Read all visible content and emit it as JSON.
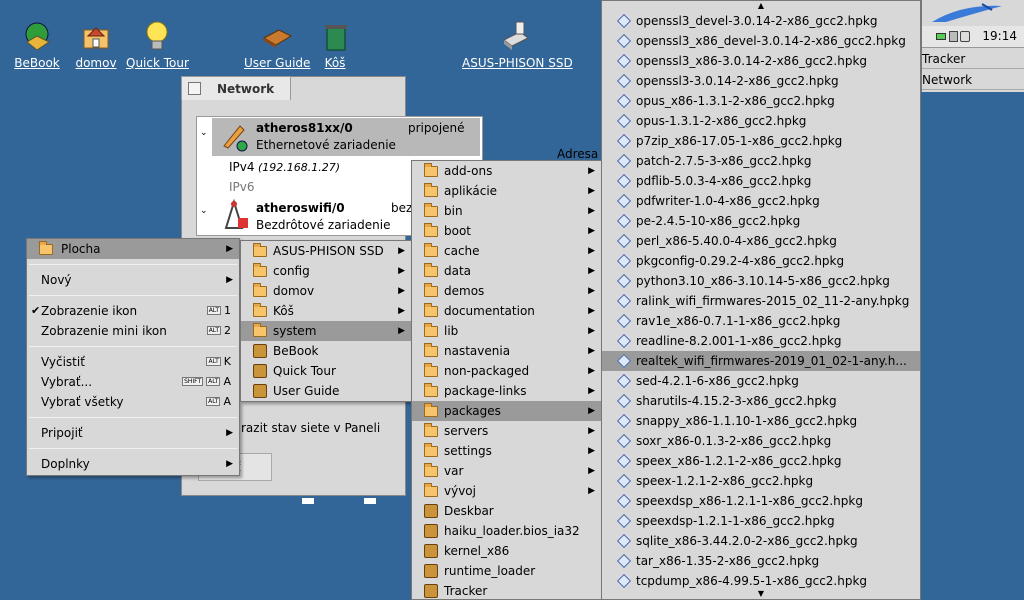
{
  "desktop_icons": [
    {
      "label": "BeBook",
      "icon": "book-globe-icon"
    },
    {
      "label": "domov",
      "icon": "home-folder-icon"
    },
    {
      "label": "Quick Tour",
      "icon": "lightbulb-icon"
    },
    {
      "label": "User Guide",
      "icon": "book-icon"
    },
    {
      "label": "Kôš",
      "icon": "trash-icon"
    },
    {
      "label": "ASUS-PHISON SSD",
      "icon": "drive-icon"
    }
  ],
  "network_window": {
    "title": "Network",
    "column_header": "Adresa",
    "iface1": {
      "name": "atheros81xx/0",
      "status": "pripojené",
      "type": "Ethernetové zariadenie",
      "ipv4_label": "IPv4",
      "ipv4_value": "(192.168.1.27)",
      "ipv6_label": "IPv6"
    },
    "iface2": {
      "name": "atheroswifi/0",
      "status": "bez",
      "type": "Bezdrôtové zariadenie"
    },
    "status_check": "razit stav siete v Paneli",
    "button": "iť"
  },
  "context_menu": {
    "items": [
      {
        "label": "Plocha",
        "submenu": true,
        "selected": true
      },
      {
        "sep": true
      },
      {
        "label": "Nový",
        "submenu": true
      },
      {
        "sep": true
      },
      {
        "label": "Zobrazenie ikon",
        "checked": true,
        "shortcut_key": "1"
      },
      {
        "label": "Zobrazenie mini ikon",
        "shortcut_key": "2"
      },
      {
        "sep": true
      },
      {
        "label": "Vyčistiť",
        "shortcut_key": "K"
      },
      {
        "label": "Vybrať...",
        "shift": true,
        "shortcut_key": "A"
      },
      {
        "label": "Vybrať všetky",
        "shortcut_key": "A"
      },
      {
        "sep": true
      },
      {
        "label": "Pripojiť",
        "submenu": true
      },
      {
        "sep": true
      },
      {
        "label": "Doplnky",
        "submenu": true
      }
    ],
    "alt_label": "ALT",
    "shift_label": "SHIFT"
  },
  "plocha_menu": [
    {
      "label": "ASUS-PHISON SSD",
      "submenu": true
    },
    {
      "label": "config",
      "submenu": true
    },
    {
      "label": "domov",
      "submenu": true
    },
    {
      "label": "Kôš",
      "submenu": true
    },
    {
      "label": "system",
      "submenu": true,
      "selected": true
    },
    {
      "label": "BeBook"
    },
    {
      "label": "Quick Tour"
    },
    {
      "label": "User Guide"
    }
  ],
  "system_menu": [
    {
      "label": "add-ons",
      "submenu": true
    },
    {
      "label": "aplikácie",
      "submenu": true
    },
    {
      "label": "bin",
      "submenu": true
    },
    {
      "label": "boot",
      "submenu": true
    },
    {
      "label": "cache",
      "submenu": true
    },
    {
      "label": "data",
      "submenu": true
    },
    {
      "label": "demos",
      "submenu": true
    },
    {
      "label": "documentation",
      "submenu": true
    },
    {
      "label": "lib",
      "submenu": true
    },
    {
      "label": "nastavenia",
      "submenu": true
    },
    {
      "label": "non-packaged",
      "submenu": true
    },
    {
      "label": "package-links",
      "submenu": true
    },
    {
      "label": "packages",
      "submenu": true,
      "selected": true
    },
    {
      "label": "servers",
      "submenu": true
    },
    {
      "label": "settings",
      "submenu": true
    },
    {
      "label": "var",
      "submenu": true
    },
    {
      "label": "vývoj",
      "submenu": true
    },
    {
      "label": "Deskbar"
    },
    {
      "label": "haiku_loader.bios_ia32"
    },
    {
      "label": "kernel_x86"
    },
    {
      "label": "runtime_loader"
    },
    {
      "label": "Tracker"
    }
  ],
  "packages_menu": [
    "openssl3_devel-3.0.14-2-x86_gcc2.hpkg",
    "openssl3_x86_devel-3.0.14-2-x86_gcc2.hpkg",
    "openssl3_x86-3.0.14-2-x86_gcc2.hpkg",
    "openssl3-3.0.14-2-x86_gcc2.hpkg",
    "opus_x86-1.3.1-2-x86_gcc2.hpkg",
    "opus-1.3.1-2-x86_gcc2.hpkg",
    "p7zip_x86-17.05-1-x86_gcc2.hpkg",
    "patch-2.7.5-3-x86_gcc2.hpkg",
    "pdflib-5.0.3-4-x86_gcc2.hpkg",
    "pdfwriter-1.0-4-x86_gcc2.hpkg",
    "pe-2.4.5-10-x86_gcc2.hpkg",
    "perl_x86-5.40.0-4-x86_gcc2.hpkg",
    "pkgconfig-0.29.2-4-x86_gcc2.hpkg",
    "python3.10_x86-3.10.14-5-x86_gcc2.hpkg",
    "ralink_wifi_firmwares-2015_02_11-2-any.hpkg",
    "rav1e_x86-0.7.1-1-x86_gcc2.hpkg",
    "readline-8.2.001-1-x86_gcc2.hpkg",
    "realtek_wifi_firmwares-2019_01_02-1-any.h...",
    "sed-4.2.1-6-x86_gcc2.hpkg",
    "sharutils-4.15.2-3-x86_gcc2.hpkg",
    "snappy_x86-1.1.10-1-x86_gcc2.hpkg",
    "soxr_x86-0.1.3-2-x86_gcc2.hpkg",
    "speex_x86-1.2.1-2-x86_gcc2.hpkg",
    "speex-1.2.1-2-x86_gcc2.hpkg",
    "speexdsp_x86-1.2.1-1-x86_gcc2.hpkg",
    "speexdsp-1.2.1-1-x86_gcc2.hpkg",
    "sqlite_x86-3.44.2.0-2-x86_gcc2.hpkg",
    "tar_x86-1.35-2-x86_gcc2.hpkg",
    "tcpdump_x86-4.99.5-1-x86_gcc2.hpkg"
  ],
  "packages_selected_index": 17,
  "deskbar": {
    "clock": "19:14",
    "items": [
      "Tracker",
      "Network"
    ]
  }
}
